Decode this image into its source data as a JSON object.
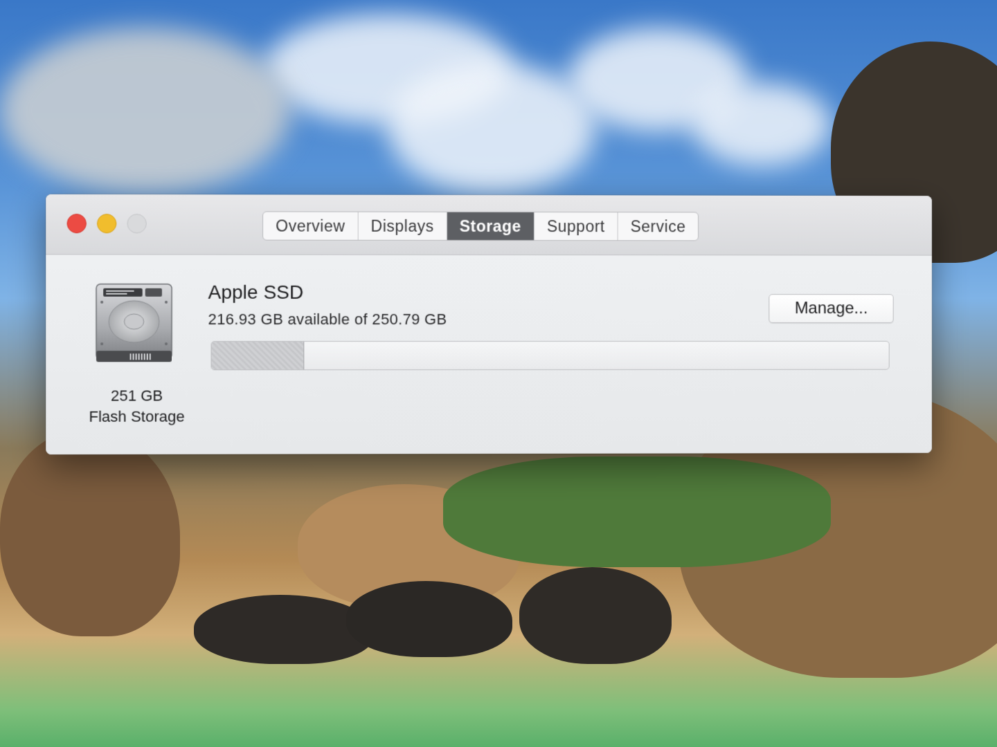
{
  "window": {
    "tabs": [
      {
        "label": "Overview",
        "active": false
      },
      {
        "label": "Displays",
        "active": false
      },
      {
        "label": "Storage",
        "active": true
      },
      {
        "label": "Support",
        "active": false
      },
      {
        "label": "Service",
        "active": false
      }
    ]
  },
  "storage": {
    "drive_icon": "hard-drive-icon",
    "capacity_label": "251 GB",
    "type_label": "Flash Storage",
    "drive_name": "Apple SSD",
    "availability_text": "216.93 GB available of 250.79 GB",
    "manage_button_label": "Manage...",
    "used_fraction": 0.135
  },
  "colors": {
    "close_button": "#ec4b43",
    "minimize_button": "#f1bd2d",
    "active_tab": "#5d5f63"
  }
}
